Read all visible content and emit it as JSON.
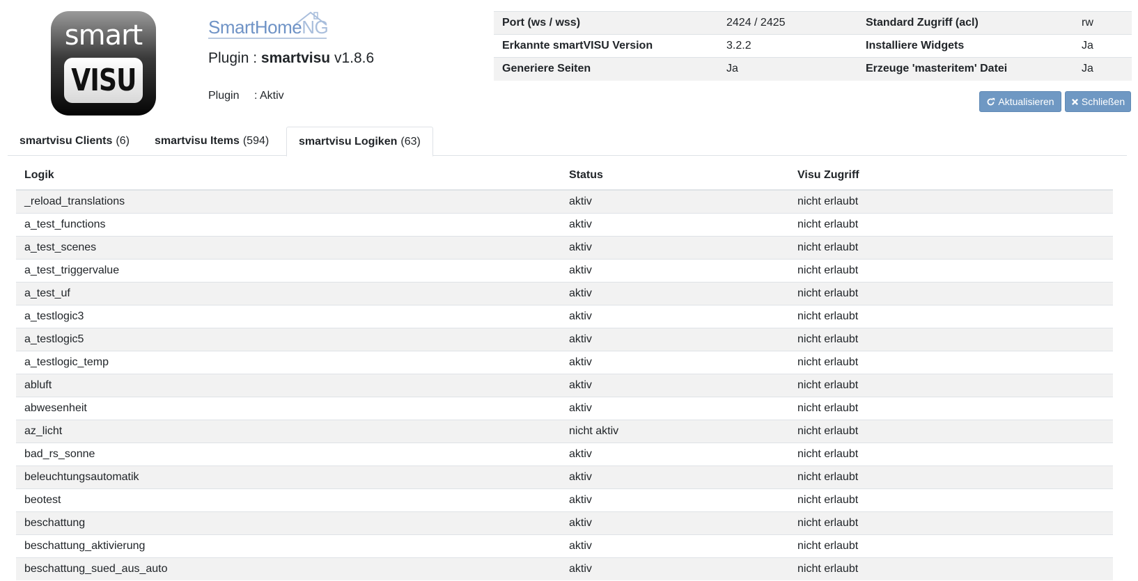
{
  "header": {
    "logo_word_top": "smart",
    "logo_word_bottom": "VISU",
    "brand_main": "SmartHome",
    "brand_suffix": "NG",
    "plugin_label": "Plugin : ",
    "plugin_name": "smartvisu",
    "plugin_version": "v1.8.6",
    "status_label": "Plugin",
    "status_value": ": Aktiv"
  },
  "info": [
    {
      "k1": "Port (ws / wss)",
      "v1": "2424 / 2425",
      "k2": "Standard Zugriff (acl)",
      "v2": "rw"
    },
    {
      "k1": "Erkannte smartVISU Version",
      "v1": "3.2.2",
      "k2": "Installiere Widgets",
      "v2": "Ja"
    },
    {
      "k1": "Generiere Seiten",
      "v1": "Ja",
      "k2": "Erzeuge 'masteritem' Datei",
      "v2": "Ja"
    }
  ],
  "buttons": {
    "refresh": "Aktualisieren",
    "close": "Schließen"
  },
  "tabs": [
    {
      "label": "smartvisu Clients",
      "count": "(6)"
    },
    {
      "label": "smartvisu Items",
      "count": "(594)"
    },
    {
      "label": "smartvisu Logiken",
      "count": "(63)"
    }
  ],
  "table": {
    "headers": [
      "Logik",
      "Status",
      "Visu Zugriff"
    ],
    "rows": [
      [
        "_reload_translations",
        "aktiv",
        "nicht erlaubt"
      ],
      [
        "a_test_functions",
        "aktiv",
        "nicht erlaubt"
      ],
      [
        "a_test_scenes",
        "aktiv",
        "nicht erlaubt"
      ],
      [
        "a_test_triggervalue",
        "aktiv",
        "nicht erlaubt"
      ],
      [
        "a_test_uf",
        "aktiv",
        "nicht erlaubt"
      ],
      [
        "a_testlogic3",
        "aktiv",
        "nicht erlaubt"
      ],
      [
        "a_testlogic5",
        "aktiv",
        "nicht erlaubt"
      ],
      [
        "a_testlogic_temp",
        "aktiv",
        "nicht erlaubt"
      ],
      [
        "abluft",
        "aktiv",
        "nicht erlaubt"
      ],
      [
        "abwesenheit",
        "aktiv",
        "nicht erlaubt"
      ],
      [
        "az_licht",
        "nicht aktiv",
        "nicht erlaubt"
      ],
      [
        "bad_rs_sonne",
        "aktiv",
        "nicht erlaubt"
      ],
      [
        "beleuchtungsautomatik",
        "aktiv",
        "nicht erlaubt"
      ],
      [
        "beotest",
        "aktiv",
        "nicht erlaubt"
      ],
      [
        "beschattung",
        "aktiv",
        "nicht erlaubt"
      ],
      [
        "beschattung_aktivierung",
        "aktiv",
        "nicht erlaubt"
      ],
      [
        "beschattung_sued_aus_auto",
        "aktiv",
        "nicht erlaubt"
      ]
    ]
  }
}
